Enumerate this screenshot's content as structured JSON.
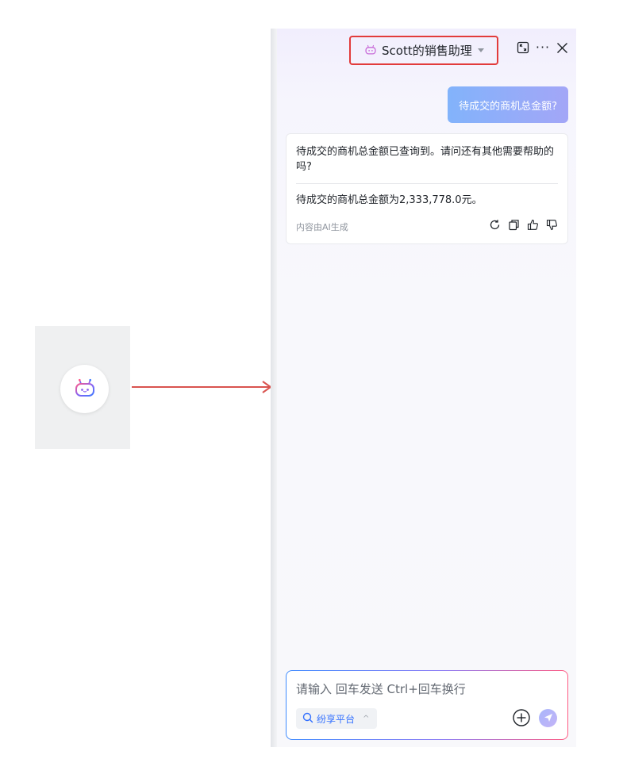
{
  "assistant": {
    "name": "Scott的销售助理",
    "icon": "robot-icon"
  },
  "header": {
    "expand_icon": "expand-icon",
    "more_icon": "more-icon",
    "more_label": "···",
    "close_icon": "close-icon"
  },
  "conversation": {
    "user_message": "待成交的商机总金额?",
    "bot_reply": "待成交的商机总金额已查询到。请问还有其他需要帮助的吗?",
    "bot_result": "待成交的商机总金额为2,333,778.0元。",
    "ai_note": "内容由AI生成",
    "actions": [
      "refresh-icon",
      "copy-icon",
      "thumbs-up-icon",
      "thumbs-down-icon"
    ]
  },
  "composer": {
    "placeholder": "请输入 回车发送 Ctrl+回车换行",
    "value": "",
    "platform_label": "纷享平台",
    "platform_chevron": "^"
  },
  "colors": {
    "highlight": "#e23b3b",
    "accent": "#3370ff",
    "user_bubble_start": "#82b3fb",
    "user_bubble_end": "#a3a6f7",
    "arrow": "#d9534f"
  }
}
